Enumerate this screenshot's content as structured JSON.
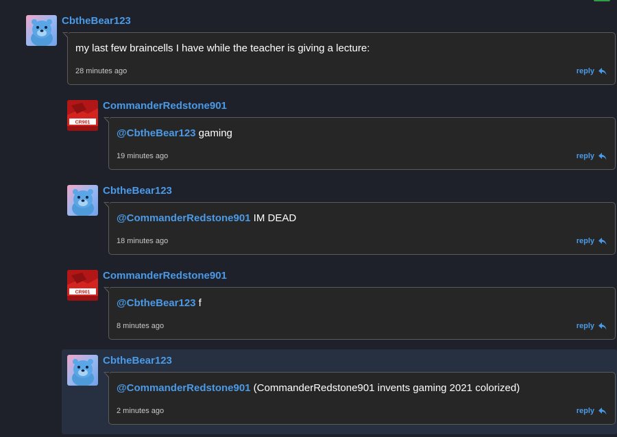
{
  "comments": [
    {
      "username": "CbtheBear123",
      "avatar": "bear-avatar",
      "mention": "",
      "text": "my last few braincells I have while the teacher is giving a lecture:",
      "time": "28 minutes ago",
      "reply": "reply"
    },
    {
      "username": "CommanderRedstone901",
      "avatar": "redstone-avatar",
      "mention": "@CbtheBear123",
      "text": " gaming",
      "time": "19 minutes ago",
      "reply": "reply"
    },
    {
      "username": "CbtheBear123",
      "avatar": "bear-avatar",
      "mention": "@CommanderRedstone901",
      "text": " IM DEAD",
      "time": "18 minutes ago",
      "reply": "reply"
    },
    {
      "username": "CommanderRedstone901",
      "avatar": "redstone-avatar",
      "mention": "@CbtheBear123",
      "text": " f",
      "time": "8 minutes ago",
      "reply": "reply"
    },
    {
      "username": "CbtheBear123",
      "avatar": "bear-avatar",
      "mention": "@CommanderRedstone901",
      "text": " (CommanderRedstone901 invents gaming 2021 colorized)",
      "time": "2 minutes ago",
      "reply": "reply"
    }
  ],
  "colors": {
    "background": "#1e2129",
    "bubble": "#262626",
    "link": "#4a9ae8",
    "highlight": "#263041"
  }
}
